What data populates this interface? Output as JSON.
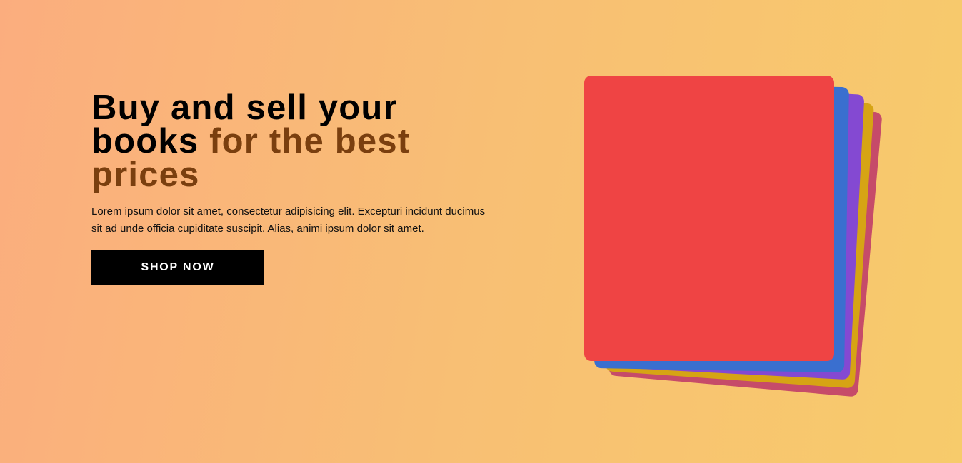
{
  "hero": {
    "headline_part1": "Buy and sell your books",
    "headline_part2": "for the best prices",
    "description": "Lorem ipsum dolor sit amet, consectetur adipisicing elit. Excepturi incidunt ducimus sit ad unde officia cupiditate suscipit. Alias, animi ipsum dolor sit amet.",
    "cta_label": "SHOP NOW"
  },
  "colors": {
    "background_start": "#fbad7e",
    "background_end": "#f7cb6b",
    "headline": "#000000",
    "headline_accent": "#7a3f0f",
    "cta_background": "#000000",
    "cta_text": "#ffffff",
    "books": [
      "#ef4444",
      "#3a6fcf",
      "#8449d2",
      "#d6a414",
      "#c64b69"
    ]
  }
}
